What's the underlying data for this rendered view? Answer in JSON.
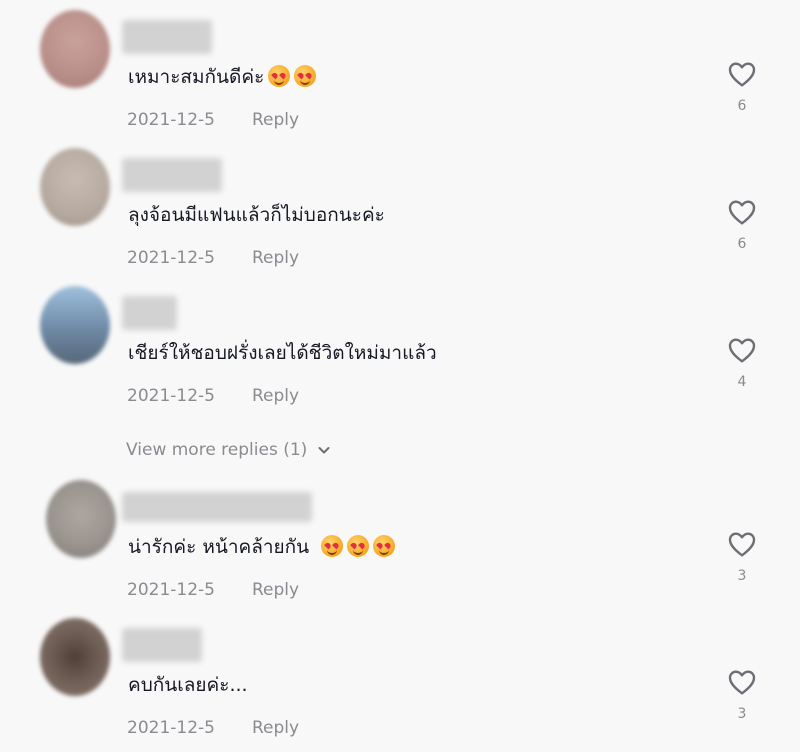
{
  "comments": [
    {
      "text": "เหมาะสมกันดีค่ะ",
      "emoji_count": 2,
      "date": "2021-12-5",
      "reply": "Reply",
      "likes": "6",
      "avatar_color": "#b98e88",
      "username_width": 90
    },
    {
      "text": "ลุงจ้อนมีแฟนแล้วก็ไม่บอกนะค่ะ",
      "emoji_count": 0,
      "date": "2021-12-5",
      "reply": "Reply",
      "likes": "6",
      "avatar_color": "#b6aaa0",
      "username_width": 100
    },
    {
      "text": "เชียร์ให้ชอบฝรั่งเลยได้ชีวิตใหม่มาแล้ว",
      "emoji_count": 0,
      "date": "2021-12-5",
      "reply": "Reply",
      "likes": "4",
      "avatar_color": "#6f8aa6",
      "username_width": 55
    },
    {
      "text": "น่ารักค่ะ หน้าคล้ายกัน",
      "emoji_count": 3,
      "date": "2021-12-5",
      "reply": "Reply",
      "likes": "3",
      "avatar_color": "#9a948f",
      "username_width": 190
    },
    {
      "text": "คบกันเลยค่ะ...",
      "emoji_count": 0,
      "date": "2021-12-5",
      "reply": "Reply",
      "likes": "3",
      "avatar_color": "#6e5d54",
      "username_width": 80
    }
  ],
  "view_more": {
    "label": "View more replies (1)"
  },
  "icons": {
    "like": "heart-outline-icon",
    "expand": "chevron-down-icon",
    "emoji": "smiling-face-with-hearts-icon"
  }
}
